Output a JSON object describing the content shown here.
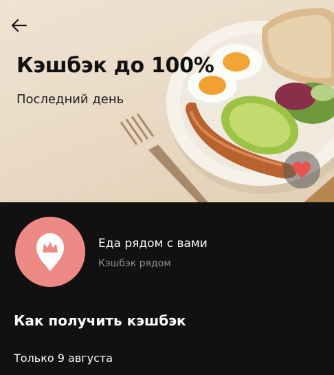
{
  "header": {
    "back_icon": "arrow-left-icon",
    "title": "Кэшбэк до 100%",
    "subtitle": "Последний день",
    "favorite_icon": "heart-icon"
  },
  "merchant": {
    "logo_icon": "crown-pin-icon",
    "name": "Еда рядом с вами",
    "subtitle": "Кэшбэк рядом"
  },
  "section": {
    "title": "Как получить кэшбэк",
    "text": "Только 9 августа"
  },
  "colors": {
    "hero_background": "#e9d9c3",
    "dark_background": "#111111",
    "logo_background": "#ee8a85",
    "heart": "#e8534c"
  }
}
